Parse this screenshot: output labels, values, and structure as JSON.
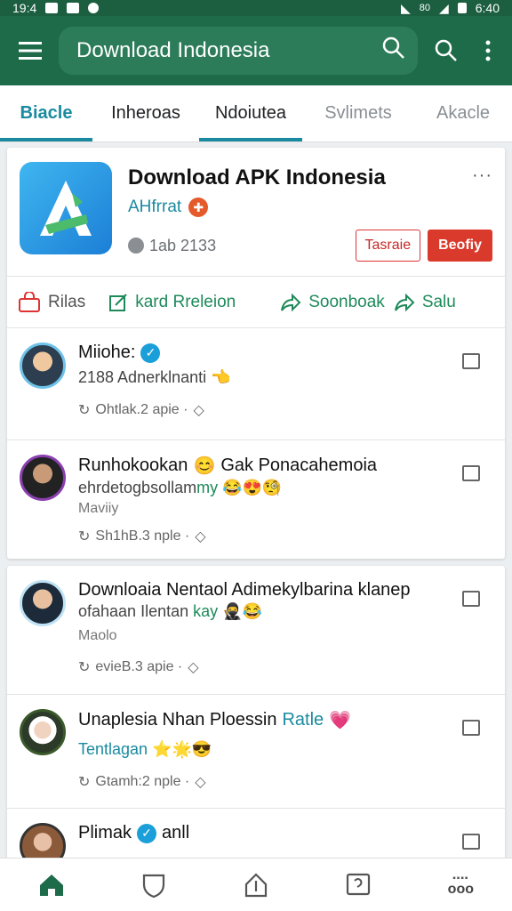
{
  "status_bar": {
    "time": "19:4",
    "right_time": "6:40",
    "battery_label": "80"
  },
  "app_bar": {
    "search_text": "Download Indonesia"
  },
  "tabs": [
    {
      "label": "Biacle"
    },
    {
      "label": "Inheroas"
    },
    {
      "label": "Ndoiutea"
    },
    {
      "label": "Svlimets"
    },
    {
      "label": "Akacle"
    }
  ],
  "app_card": {
    "title": "Download APK Indonesia",
    "developer": "AHfrrat",
    "downloads": "1ab 2133",
    "btn_outline": "Tasraie",
    "btn_fill": "Beofiy",
    "actions": [
      {
        "label": "Rilas"
      },
      {
        "label": "kard Rreleion"
      },
      {
        "label": "Soonboak"
      },
      {
        "label": "Salu"
      }
    ]
  },
  "feed_group_1": [
    {
      "name": "Miiohe:",
      "line1": "2188 Adnerklnanti",
      "emoji1": "👈",
      "meta": "Ohtlak.2 apie ·"
    },
    {
      "name": "Runhokookan",
      "emoji_name": "😊",
      "name_rest": "Gak Ponacahemoia",
      "line1": "ehrdetogbsollam",
      "line1_green": "my",
      "line1_emoji": "😂😍🧐",
      "muted": "Maviiy",
      "meta": "Sh1hB.3 nple ·"
    }
  ],
  "feed_group_2": [
    {
      "name": "Downloaia Nentaol Adimekylbarina klanep",
      "line1": "ofahaan Ilentan",
      "line1_green": "kay",
      "line1_emoji": "🥷😂",
      "muted": "Maolo",
      "meta": "evieB.3 apie ·"
    },
    {
      "name": "Unaplesia Nhan Ploessin",
      "name_teal": "Ratle",
      "emoji_name": "💗",
      "line1_teal": "Tentlagan",
      "line1_emoji": "⭐🌟😎",
      "meta": "Gtamh:2 nple ·"
    },
    {
      "name": "Plimak",
      "name_rest": "anll"
    }
  ],
  "bottom_nav": [
    {
      "icon": "home-icon"
    },
    {
      "icon": "shield-icon"
    },
    {
      "icon": "upload-icon"
    },
    {
      "icon": "chat-icon"
    },
    {
      "icon": "more-apps-icon",
      "label": "ooo"
    }
  ]
}
